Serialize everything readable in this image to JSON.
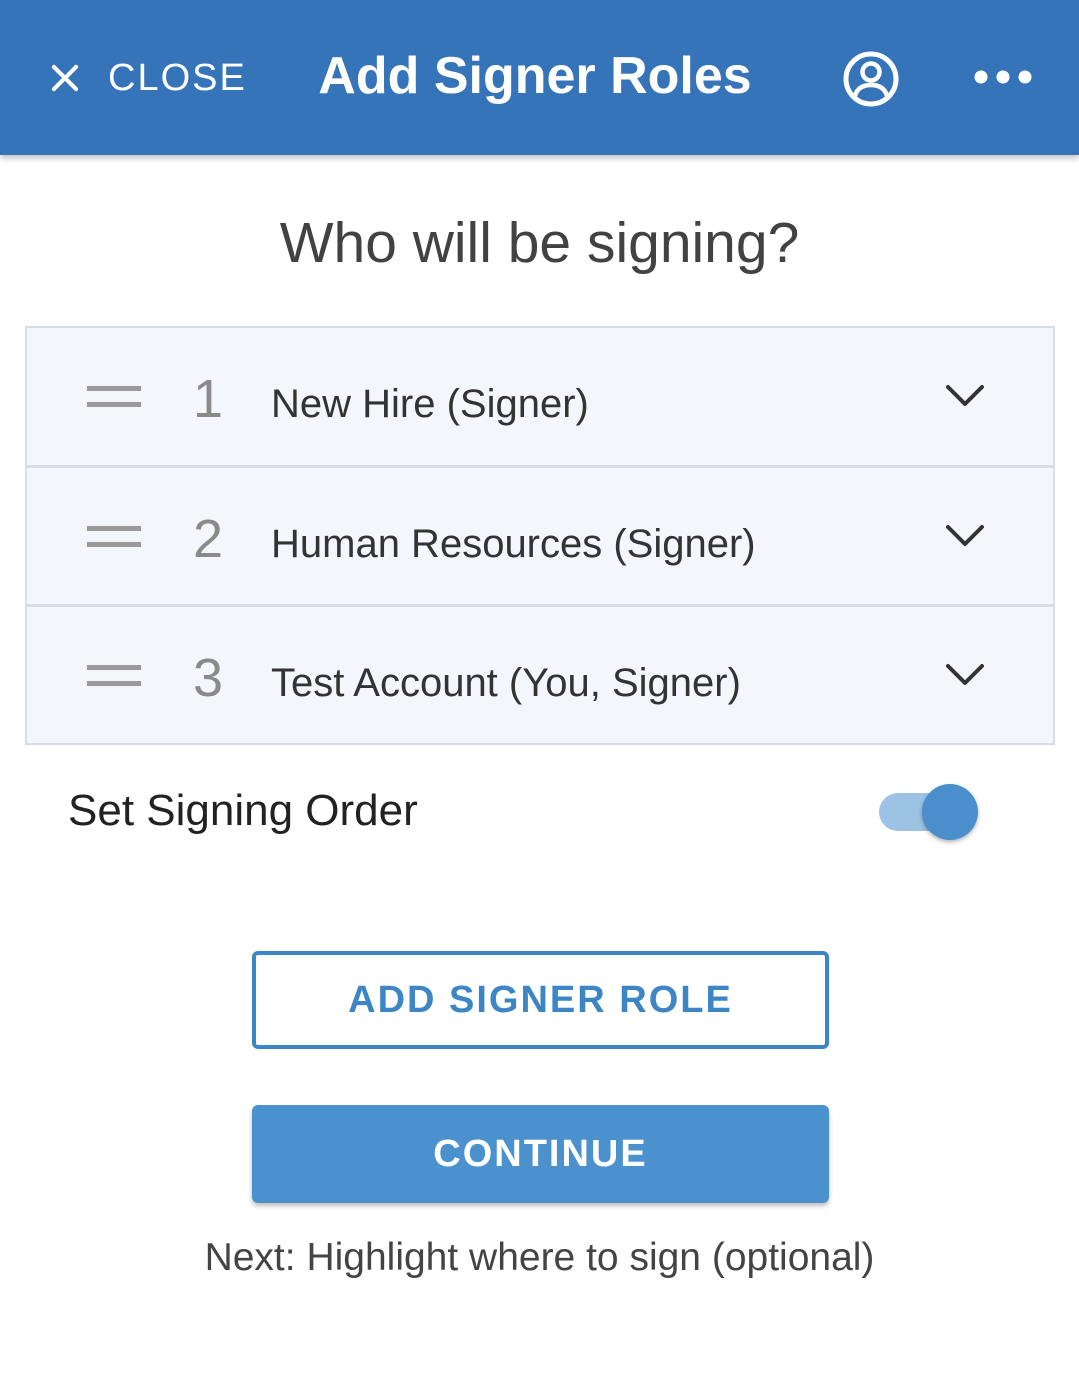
{
  "header": {
    "close_label": "CLOSE",
    "title": "Add Signer Roles",
    "icons": [
      "close-icon",
      "account-circle-icon",
      "more-horizontal-icon"
    ]
  },
  "main": {
    "question": "Who will be signing?",
    "roles": [
      {
        "number": "1",
        "name": "New Hire (Signer)"
      },
      {
        "number": "2",
        "name": "Human Resources (Signer)"
      },
      {
        "number": "3",
        "name": "Test Account (You, Signer)"
      }
    ],
    "signing_order": {
      "label": "Set Signing Order",
      "enabled": true
    },
    "add_role_label": "ADD SIGNER ROLE",
    "continue_label": "CONTINUE",
    "next_hint": "Next: Highlight where to sign (optional)"
  },
  "colors": {
    "header_bg": "#3574b8",
    "accent": "#4a91cd",
    "list_bg": "#f3f6fb"
  }
}
